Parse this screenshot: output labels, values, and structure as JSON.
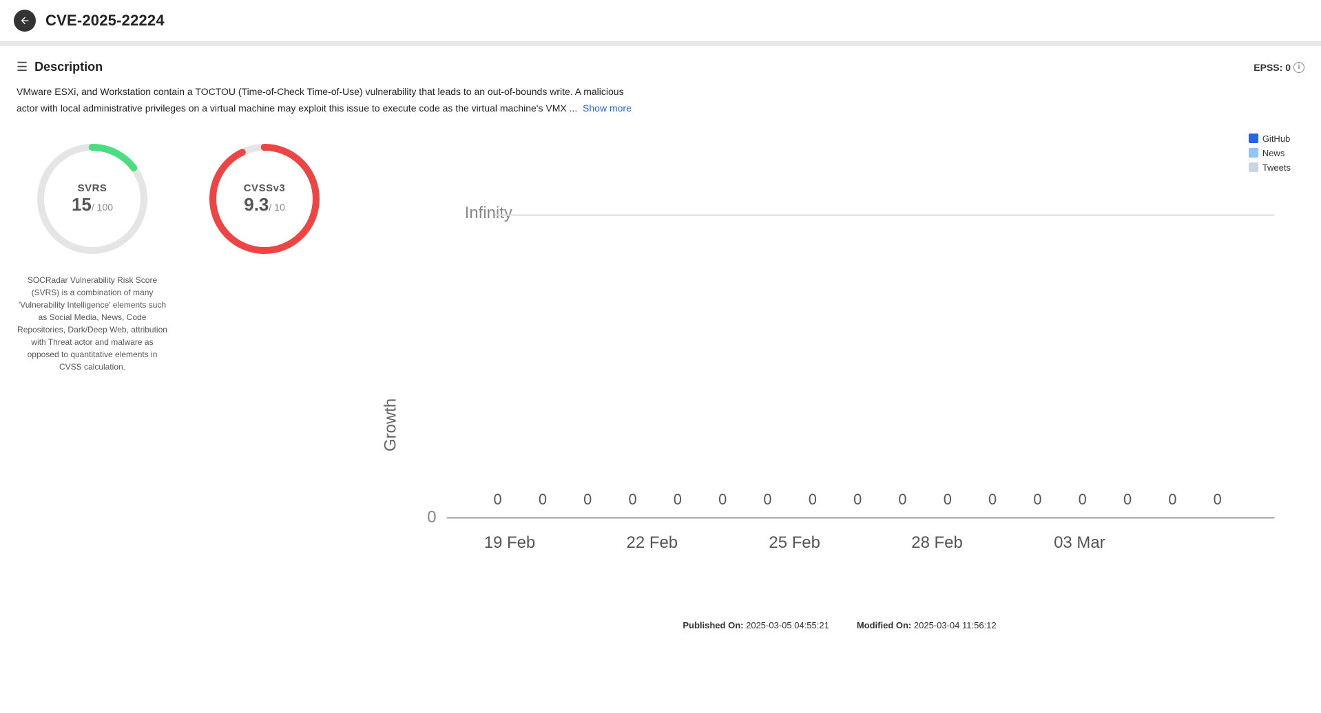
{
  "header": {
    "title": "CVE-2025-22224",
    "back_label": "back"
  },
  "section": {
    "title": "Description",
    "epss_label": "EPSS:",
    "epss_value": "0"
  },
  "description": {
    "text": "VMware ESXi, and Workstation contain a TOCTOU (Time-of-Check Time-of-Use) vulnerability that leads to an out-of-bounds write. A malicious actor with local administrative privileges on a virtual machine may exploit this issue to execute code as the virtual machine's VMX ...",
    "show_more": "Show more"
  },
  "svrs": {
    "label": "SVRS",
    "value": "15",
    "denom": "/ 100",
    "description": "SOCRadar Vulnerability Risk Score (SVRS) is a combination of many 'Vulnerability Intelligence' elements such as Social Media, News, Code Repositories, Dark/Deep Web, attribution with Threat actor and malware as opposed to quantitative elements in CVSS calculation."
  },
  "cvss": {
    "label": "CVSSv3",
    "value": "9.3",
    "denom": "/ 10"
  },
  "chart": {
    "y_label": "Growth",
    "y_top": "Infinity",
    "y_zero": "0",
    "x_labels": [
      "19 Feb",
      "22 Feb",
      "25 Feb",
      "28 Feb",
      "03 Mar"
    ],
    "bar_values": [
      "0",
      "0",
      "0",
      "0",
      "0",
      "0",
      "0",
      "0",
      "0",
      "0",
      "0",
      "0",
      "0",
      "0",
      "0",
      "0",
      "0"
    ],
    "legend": [
      {
        "label": "GitHub",
        "color": "#2563eb"
      },
      {
        "label": "News",
        "color": "#93c5fd"
      },
      {
        "label": "Tweets",
        "color": "#cbd5e1"
      }
    ]
  },
  "footer": {
    "published_label": "Published On:",
    "published_value": "2025-03-05 04:55:21",
    "modified_label": "Modified On:",
    "modified_value": "2025-03-04 11:56:12"
  }
}
